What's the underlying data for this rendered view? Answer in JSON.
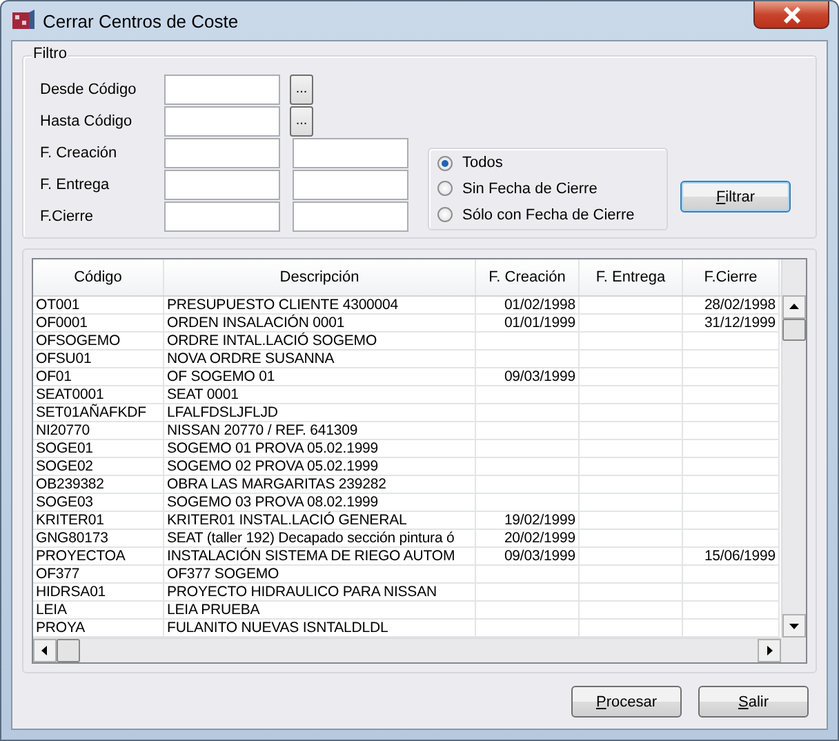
{
  "window": {
    "title": "Cerrar Centros de Coste"
  },
  "filter": {
    "title": "Filtro",
    "fields": [
      {
        "label": "Desde Código",
        "kind": "lookup"
      },
      {
        "label": "Hasta Código",
        "kind": "lookup"
      },
      {
        "label": "F. Creación",
        "kind": "range"
      },
      {
        "label": "F. Entrega",
        "kind": "range"
      },
      {
        "label": "F.Cierre",
        "kind": "range"
      }
    ],
    "options": [
      {
        "label": "Todos",
        "selected": true
      },
      {
        "label": "Sin Fecha de Cierre",
        "selected": false
      },
      {
        "label": "Sólo con Fecha de Cierre",
        "selected": false
      }
    ],
    "lookup_button": "...",
    "filter_button": {
      "label": "Filtrar",
      "mnemonic": true
    }
  },
  "table": {
    "columns": [
      "Código",
      "Descripción",
      "F. Creación",
      "F. Entrega",
      "F.Cierre"
    ],
    "rows": [
      [
        "OT001",
        "PRESUPUESTO CLIENTE 4300004",
        "01/02/1998",
        "",
        "28/02/1998"
      ],
      [
        "OF0001",
        "ORDEN INSALACIÓN 0001",
        "01/01/1999",
        "",
        "31/12/1999"
      ],
      [
        "OFSOGEMO",
        "ORDRE INTAL.LACIÓ SOGEMO",
        "",
        "",
        ""
      ],
      [
        "OFSU01",
        "NOVA ORDRE SUSANNA",
        "",
        "",
        ""
      ],
      [
        "OF01",
        "OF SOGEMO 01",
        "09/03/1999",
        "",
        ""
      ],
      [
        "SEAT0001",
        "SEAT 0001",
        "",
        "",
        ""
      ],
      [
        "SET01AÑAFKDF",
        "LFALFDSLJFLJD",
        "",
        "",
        ""
      ],
      [
        "NI20770",
        "NISSAN 20770 / REF. 641309",
        "",
        "",
        ""
      ],
      [
        "SOGE01",
        "SOGEMO 01 PROVA 05.02.1999",
        "",
        "",
        ""
      ],
      [
        "SOGE02",
        "SOGEMO 02 PROVA 05.02.1999",
        "",
        "",
        ""
      ],
      [
        "OB239382",
        "OBRA LAS MARGARITAS 239282",
        "",
        "",
        ""
      ],
      [
        "SOGE03",
        "SOGEMO 03 PROVA 08.02.1999",
        "",
        "",
        ""
      ],
      [
        "KRITER01",
        "KRITER01 INSTAL.LACIÓ GENERAL",
        "19/02/1999",
        "",
        ""
      ],
      [
        "GNG80173",
        "SEAT  (taller 192) Decapado sección pintura ó",
        "20/02/1999",
        "",
        ""
      ],
      [
        "PROYECTOA",
        "INSTALACIÓN SISTEMA DE RIEGO AUTOM",
        "09/03/1999",
        "",
        "15/06/1999"
      ],
      [
        "OF377",
        "OF377 SOGEMO",
        "",
        "",
        ""
      ],
      [
        "HIDRSA01",
        "PROYECTO HIDRAULICO PARA NISSAN",
        "",
        "",
        ""
      ],
      [
        "LEIA",
        "LEIA PRUEBA",
        "",
        "",
        ""
      ],
      [
        "PROYA",
        "FULANITO NUEVAS ISNTALDLDL",
        "",
        "",
        ""
      ]
    ]
  },
  "buttons": [
    {
      "label": "Procesar",
      "mnemonic": true
    },
    {
      "label": "Salir",
      "mnemonic": true
    }
  ]
}
